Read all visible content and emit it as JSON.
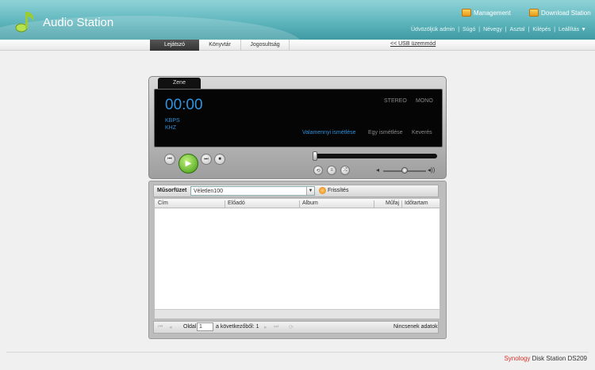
{
  "header": {
    "app_title": "Audio Station",
    "management_label": "Management",
    "download_label": "Download Station",
    "user_links": [
      "Üdvözöljük admin",
      "Súgó",
      "Névegy",
      "Asztal",
      "Kilépés",
      "Leállítás ▼"
    ],
    "user_links_separator": "|"
  },
  "nav": {
    "tabs": [
      "Lejátszó",
      "Könyvtár",
      "Jogosultság"
    ],
    "usb_mode": "<< USB üzemmód"
  },
  "player": {
    "tab_label": "Zene",
    "time": "00:00",
    "kbps_label": "KBPS",
    "khz_label": "KHZ",
    "stereo_label": "STEREO",
    "mono_label": "MONO",
    "repeat_all": "Valamennyi ismétlése",
    "repeat_one": "Egy ismétlése",
    "shuffle": "Keverés",
    "progress": 0
  },
  "playlist": {
    "label": "Műsorfüzet",
    "selected": "Véletlen100",
    "refresh_label": "Frissítés",
    "columns": [
      "Cím",
      "Előadó",
      "Album",
      "Műfaj",
      "Időtartam"
    ]
  },
  "pager": {
    "page_label": "Oldal",
    "page_value": "1",
    "of_label": "a következőből: 1",
    "no_data": "Nincsenek adatok"
  },
  "footer": {
    "brand": "Synology",
    "product": "Disk Station DS209"
  },
  "colors": {
    "accent_blue": "#2f93e0",
    "play_green": "#3f9a12",
    "header_teal": "#5fb6bd"
  }
}
